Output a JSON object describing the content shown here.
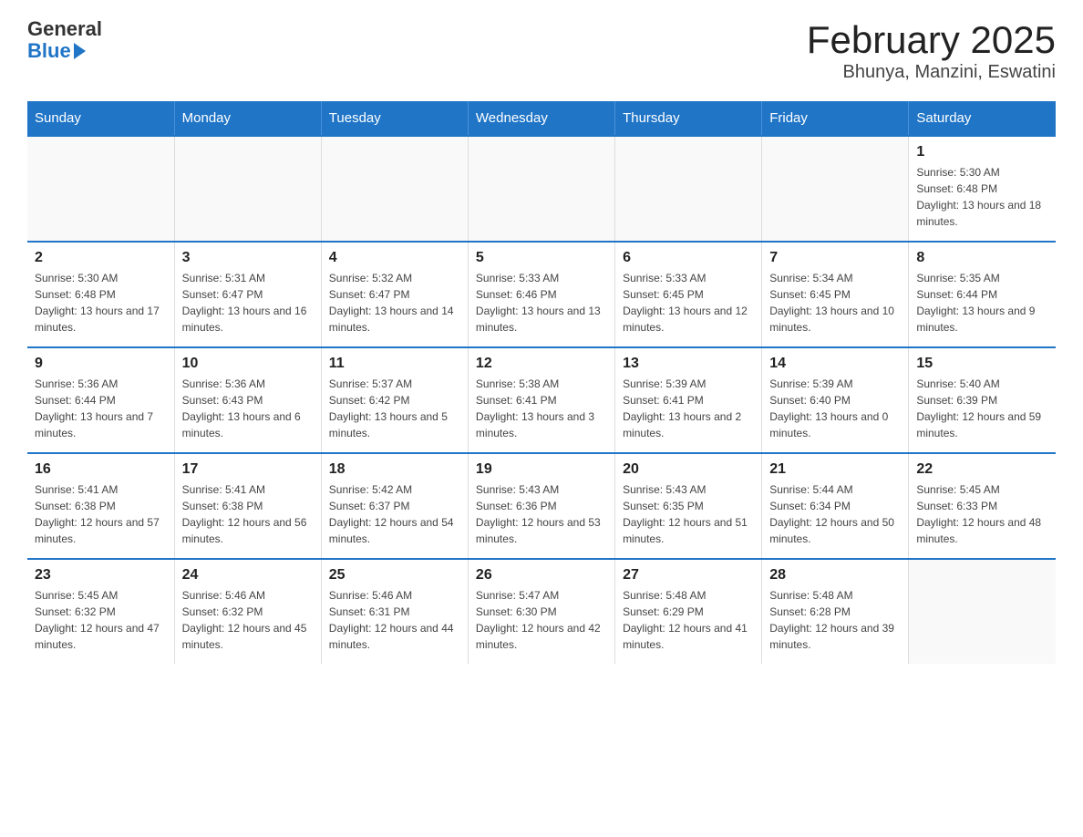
{
  "header": {
    "logo_general": "General",
    "logo_blue": "Blue",
    "title": "February 2025",
    "subtitle": "Bhunya, Manzini, Eswatini"
  },
  "days_of_week": [
    "Sunday",
    "Monday",
    "Tuesday",
    "Wednesday",
    "Thursday",
    "Friday",
    "Saturday"
  ],
  "weeks": [
    [
      {
        "day": "",
        "info": ""
      },
      {
        "day": "",
        "info": ""
      },
      {
        "day": "",
        "info": ""
      },
      {
        "day": "",
        "info": ""
      },
      {
        "day": "",
        "info": ""
      },
      {
        "day": "",
        "info": ""
      },
      {
        "day": "1",
        "info": "Sunrise: 5:30 AM\nSunset: 6:48 PM\nDaylight: 13 hours and 18 minutes."
      }
    ],
    [
      {
        "day": "2",
        "info": "Sunrise: 5:30 AM\nSunset: 6:48 PM\nDaylight: 13 hours and 17 minutes."
      },
      {
        "day": "3",
        "info": "Sunrise: 5:31 AM\nSunset: 6:47 PM\nDaylight: 13 hours and 16 minutes."
      },
      {
        "day": "4",
        "info": "Sunrise: 5:32 AM\nSunset: 6:47 PM\nDaylight: 13 hours and 14 minutes."
      },
      {
        "day": "5",
        "info": "Sunrise: 5:33 AM\nSunset: 6:46 PM\nDaylight: 13 hours and 13 minutes."
      },
      {
        "day": "6",
        "info": "Sunrise: 5:33 AM\nSunset: 6:45 PM\nDaylight: 13 hours and 12 minutes."
      },
      {
        "day": "7",
        "info": "Sunrise: 5:34 AM\nSunset: 6:45 PM\nDaylight: 13 hours and 10 minutes."
      },
      {
        "day": "8",
        "info": "Sunrise: 5:35 AM\nSunset: 6:44 PM\nDaylight: 13 hours and 9 minutes."
      }
    ],
    [
      {
        "day": "9",
        "info": "Sunrise: 5:36 AM\nSunset: 6:44 PM\nDaylight: 13 hours and 7 minutes."
      },
      {
        "day": "10",
        "info": "Sunrise: 5:36 AM\nSunset: 6:43 PM\nDaylight: 13 hours and 6 minutes."
      },
      {
        "day": "11",
        "info": "Sunrise: 5:37 AM\nSunset: 6:42 PM\nDaylight: 13 hours and 5 minutes."
      },
      {
        "day": "12",
        "info": "Sunrise: 5:38 AM\nSunset: 6:41 PM\nDaylight: 13 hours and 3 minutes."
      },
      {
        "day": "13",
        "info": "Sunrise: 5:39 AM\nSunset: 6:41 PM\nDaylight: 13 hours and 2 minutes."
      },
      {
        "day": "14",
        "info": "Sunrise: 5:39 AM\nSunset: 6:40 PM\nDaylight: 13 hours and 0 minutes."
      },
      {
        "day": "15",
        "info": "Sunrise: 5:40 AM\nSunset: 6:39 PM\nDaylight: 12 hours and 59 minutes."
      }
    ],
    [
      {
        "day": "16",
        "info": "Sunrise: 5:41 AM\nSunset: 6:38 PM\nDaylight: 12 hours and 57 minutes."
      },
      {
        "day": "17",
        "info": "Sunrise: 5:41 AM\nSunset: 6:38 PM\nDaylight: 12 hours and 56 minutes."
      },
      {
        "day": "18",
        "info": "Sunrise: 5:42 AM\nSunset: 6:37 PM\nDaylight: 12 hours and 54 minutes."
      },
      {
        "day": "19",
        "info": "Sunrise: 5:43 AM\nSunset: 6:36 PM\nDaylight: 12 hours and 53 minutes."
      },
      {
        "day": "20",
        "info": "Sunrise: 5:43 AM\nSunset: 6:35 PM\nDaylight: 12 hours and 51 minutes."
      },
      {
        "day": "21",
        "info": "Sunrise: 5:44 AM\nSunset: 6:34 PM\nDaylight: 12 hours and 50 minutes."
      },
      {
        "day": "22",
        "info": "Sunrise: 5:45 AM\nSunset: 6:33 PM\nDaylight: 12 hours and 48 minutes."
      }
    ],
    [
      {
        "day": "23",
        "info": "Sunrise: 5:45 AM\nSunset: 6:32 PM\nDaylight: 12 hours and 47 minutes."
      },
      {
        "day": "24",
        "info": "Sunrise: 5:46 AM\nSunset: 6:32 PM\nDaylight: 12 hours and 45 minutes."
      },
      {
        "day": "25",
        "info": "Sunrise: 5:46 AM\nSunset: 6:31 PM\nDaylight: 12 hours and 44 minutes."
      },
      {
        "day": "26",
        "info": "Sunrise: 5:47 AM\nSunset: 6:30 PM\nDaylight: 12 hours and 42 minutes."
      },
      {
        "day": "27",
        "info": "Sunrise: 5:48 AM\nSunset: 6:29 PM\nDaylight: 12 hours and 41 minutes."
      },
      {
        "day": "28",
        "info": "Sunrise: 5:48 AM\nSunset: 6:28 PM\nDaylight: 12 hours and 39 minutes."
      },
      {
        "day": "",
        "info": ""
      }
    ]
  ]
}
